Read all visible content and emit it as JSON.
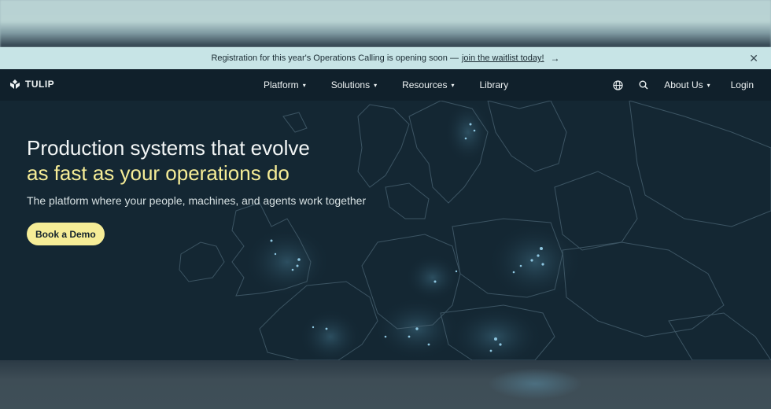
{
  "announcement": {
    "text": "Registration for this year's Operations Calling is opening soon —",
    "link_text": "join the waitlist today!",
    "arrow_icon": "arrow-right-icon",
    "close_icon": "close-icon"
  },
  "nav": {
    "brand": "TULIP",
    "logo_icon": "tulip-logo-icon",
    "items": [
      {
        "label": "Platform",
        "has_dropdown": true
      },
      {
        "label": "Solutions",
        "has_dropdown": true
      },
      {
        "label": "Resources",
        "has_dropdown": true
      },
      {
        "label": "Library",
        "has_dropdown": false
      }
    ],
    "globe_icon": "globe-icon",
    "search_icon": "search-icon",
    "about": {
      "label": "About Us",
      "has_dropdown": true
    },
    "login": "Login"
  },
  "hero": {
    "headline_line1": "Production systems that evolve",
    "headline_line2": "as fast as your operations do",
    "subheadline": "The platform where your people, machines, and agents work together",
    "cta": "Book a Demo"
  },
  "colors": {
    "announce_bg": "#c7e4e6",
    "nav_bg": "#10202b",
    "hero_bg": "#142733",
    "accent": "#f6ed97"
  }
}
